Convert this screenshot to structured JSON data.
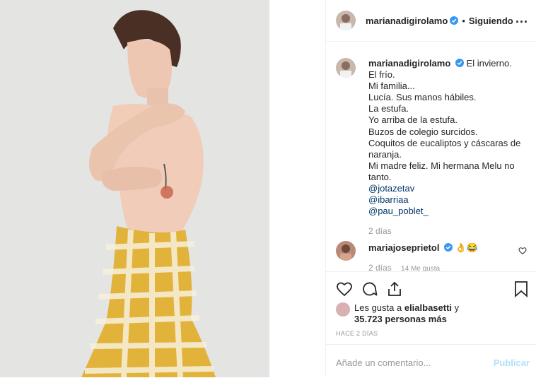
{
  "post": {
    "username": "marianadigirolamo",
    "separator": "•",
    "following_label": "Siguiendo",
    "more_label": "...",
    "caption_lines": [
      "El invierno.",
      "El frío.",
      "Mi familia...",
      "Lucía. Sus manos hábiles.",
      "La estufa.",
      "Yo arriba de la estufa.",
      "Buzos de colegio surcidos.",
      "Coquitos de eucaliptos y cáscaras de",
      "naranja.",
      "Mi madre feliz. Mi hermana Melu no",
      "tanto."
    ],
    "mentions": [
      "@jotazetav",
      "@ibarriaa",
      "@pau_poblet_"
    ],
    "caption_time": "2 días",
    "comment": {
      "username": "mariajoseprietol",
      "text": "👌😂",
      "time": "2 días",
      "likes": "14 Me gusta"
    },
    "likes_prefix": "Les gusta a",
    "likes_user": "elialbasetti",
    "likes_and": "y",
    "likes_count": "35.723 personas más",
    "date": "HACE 2 DÍAS",
    "comment_placeholder": "Añade un comentario...",
    "post_button": "Publicar"
  },
  "colors": {
    "verified": "#3897f0",
    "link": "#003569",
    "muted": "#999999",
    "post_button": "#b2dffc"
  },
  "icons": [
    "verified-icon",
    "more-icon",
    "heart-icon",
    "comment-icon",
    "share-icon",
    "bookmark-icon"
  ]
}
